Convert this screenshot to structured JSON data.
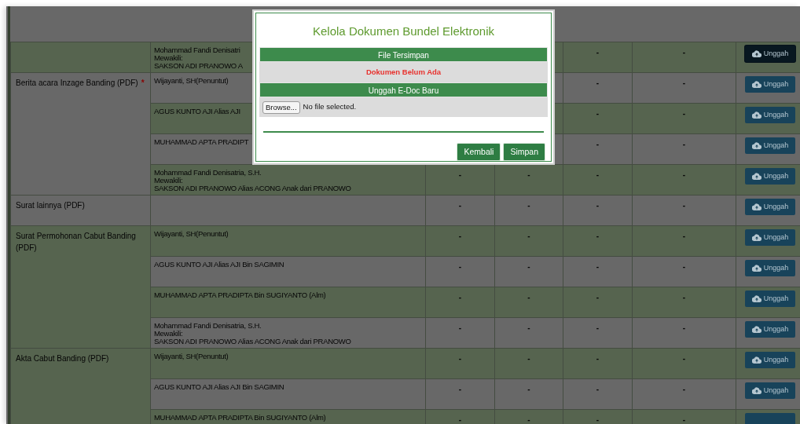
{
  "modal": {
    "title": "Kelola Dokumen Bundel Elektronik",
    "saved_header": "File Tersimpan",
    "saved_status": "Dokumen Belum Ada",
    "upload_header": "Unggah E-Doc Baru",
    "file_button": "Browse...",
    "file_status": "No file selected.",
    "buttons": [
      "Kembali",
      "Simpan"
    ]
  },
  "table": {
    "groups": [
      {
        "rows": [
          {
            "party": "Mohammad Fandi Denisatri\nMewakili:\nSAKSON ADI PRANOWO A",
            "cells": [
              null,
              null,
              "-",
              "-"
            ],
            "action": "Unggah",
            "focused": true
          }
        ]
      },
      {
        "label": "Berita acara Inzage Banding (PDF)",
        "required": "*",
        "rows": [
          {
            "party": "Wijayanti, SH(Penuntut)",
            "cells": [
              null,
              null,
              "-",
              "-"
            ],
            "action": "Unggah",
            "focused": false
          },
          {
            "party": "AGUS KUNTO AJI Alias AJI",
            "cells": [
              null,
              null,
              "-",
              "-"
            ],
            "action": "Unggah",
            "focused": false
          },
          {
            "party": "MUHAMMAD APTA PRADIPT",
            "cells": [
              null,
              null,
              "-",
              "-"
            ],
            "action": "Unggah",
            "focused": false
          },
          {
            "party": "Mohammad Fandi Denisatria, S.H.\nMewakili:\nSAKSON ADI PRANOWO Alias ACONG Anak dari PRANOWO",
            "cells": [
              "-",
              "-",
              "-",
              "-"
            ],
            "action": "Unggah",
            "focused": false
          }
        ]
      },
      {
        "label": "Surat lainnya (PDF)",
        "rows": [
          {
            "cells": [
              "-",
              "-",
              "-",
              "-"
            ],
            "action": "Unggah",
            "focused": false
          }
        ]
      },
      {
        "label": "Surat Permohonan Cabut Banding (PDF)",
        "rows": [
          {
            "party": "Wijayanti, SH(Penuntut)",
            "cells": [
              "-",
              "-",
              "-",
              "-"
            ],
            "action": "Unggah",
            "focused": false
          },
          {
            "party": "AGUS KUNTO AJI Alias AJI Bin SAGIMIN",
            "cells": [
              "-",
              "-",
              "-",
              "-"
            ],
            "action": "Unggah",
            "focused": false
          },
          {
            "party": "MUHAMMAD APTA PRADIPTA Bin SUGIYANTO (Alm)",
            "cells": [
              "-",
              "-",
              "-",
              "-"
            ],
            "action": "Unggah",
            "focused": false
          },
          {
            "party": "Mohammad Fandi Denisatria, S.H.\nMewakili:\nSAKSON ADI PRANOWO Alias ACONG Anak dari PRANOWO",
            "cells": [
              "-",
              "-",
              "-",
              "-"
            ],
            "action": "Unggah",
            "focused": false
          }
        ]
      },
      {
        "label": "Akta Cabut Banding (PDF)",
        "rows": [
          {
            "party": "Wijayanti, SH(Penuntut)",
            "cells": [
              "-",
              "-",
              "-",
              "-"
            ],
            "action": "Unggah",
            "focused": false
          },
          {
            "party": "AGUS KUNTO AJI Alias AJI Bin SAGIMIN",
            "cells": [
              "-",
              "-",
              "-",
              "-"
            ],
            "action": "Unggah",
            "focused": false
          },
          {
            "party": "MUHAMMAD APTA PRADIPTA Bin SUGIYANTO (Alm)",
            "cells": [
              "-",
              "-",
              "-",
              "-"
            ],
            "focused": false
          }
        ]
      }
    ]
  }
}
